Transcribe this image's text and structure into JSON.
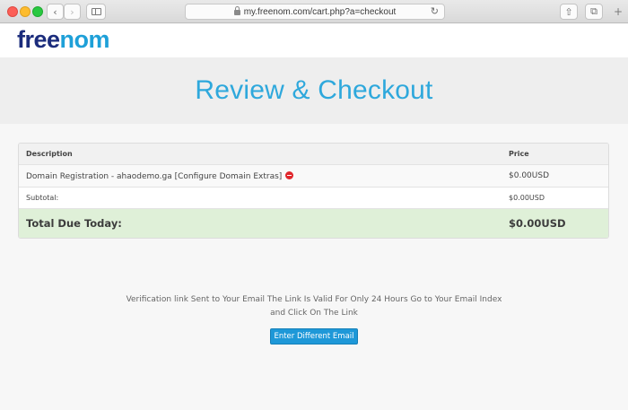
{
  "browser": {
    "url": "my.freenom.com/cart.php?a=checkout",
    "back_glyph": "‹",
    "forward_glyph": "›",
    "reload_glyph": "↻",
    "share_glyph": "⇧",
    "tabs_glyph": "⧉",
    "new_tab_glyph": "+"
  },
  "logo": {
    "part1": "free",
    "part2": "nom",
    "color_dark": "#1b2c7c",
    "color_light": "#1ea0d8"
  },
  "page": {
    "title": "Review & Checkout"
  },
  "cart": {
    "header": {
      "description": "Description",
      "price": "Price"
    },
    "items": [
      {
        "description": "Domain Registration - ahaodemo.ga [Configure Domain Extras]",
        "price": "$0.00USD",
        "remove_icon": "remove-icon"
      }
    ],
    "subtotal": {
      "label": "Subtotal:",
      "value": "$0.00USD"
    },
    "total": {
      "label": "Total Due Today:",
      "value": "$0.00USD"
    }
  },
  "verification": {
    "message": "Verification link Sent to Your Email The Link Is Valid For Only 24 Hours Go to Your Email Index and Click On The Link",
    "button_label": "Enter Different Email"
  },
  "colors": {
    "accent": "#1e98d8",
    "title": "#2ea8dc",
    "total_bg": "#dff0d8"
  }
}
